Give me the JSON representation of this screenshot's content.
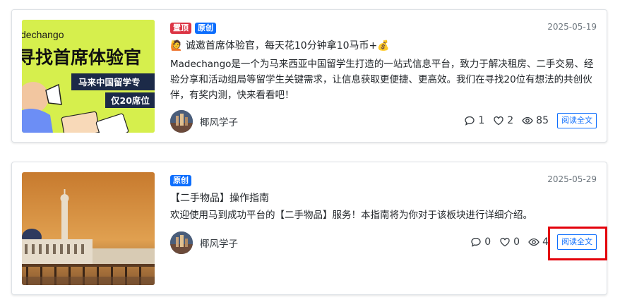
{
  "posts": [
    {
      "badges": [
        "置顶",
        "原创"
      ],
      "date": "2025-05-19",
      "title": "🙋 诚邀首席体验官，每天花10分钟拿10马币+💰",
      "description": "Madechango是一个为马来西亚中国留学生打造的一站式信息平台，致力于解决租房、二手交易、经验分享和活动组局等留学生关键需求，让信息获取更便捷、更高效。我们在寻找20位有想法的共创伙伴，有奖内测，快来看看吧！",
      "author": "椰风学子",
      "comments": "1",
      "likes": "2",
      "views": "85",
      "read_label": "阅读全文",
      "thumb": {
        "brand": "dechango",
        "headline": "寻找首席体验官",
        "banner1": "马来中国留学专",
        "banner2": "仅20席位"
      }
    },
    {
      "badges": [
        "原创"
      ],
      "date": "2025-05-29",
      "title": "【二手物品】操作指南",
      "description": "欢迎使用马到成功平台的【二手物品】服务！本指南将为你对于该板块进行详细介绍。",
      "author": "椰风学子",
      "comments": "0",
      "likes": "0",
      "views": "4",
      "read_label": "阅读全文"
    }
  ]
}
